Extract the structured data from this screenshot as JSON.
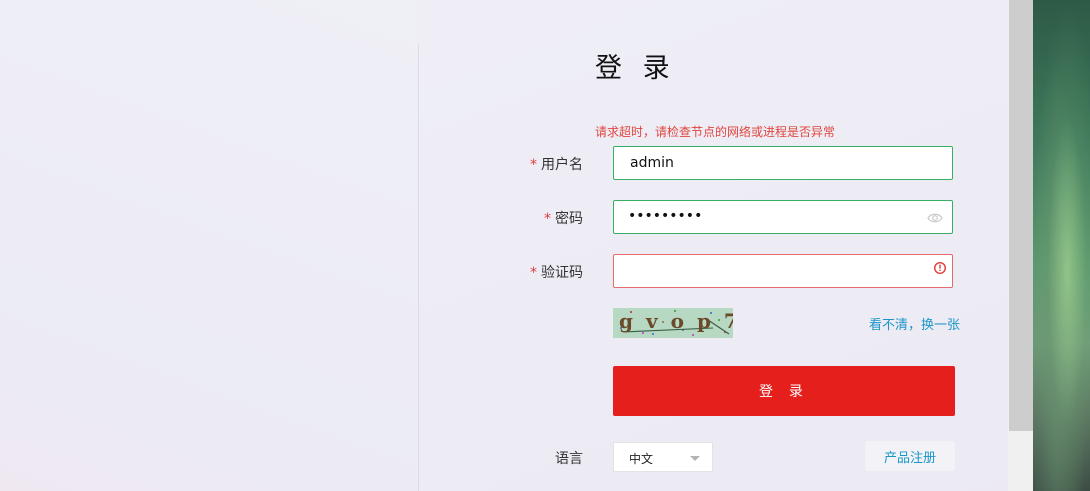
{
  "login": {
    "title": "登 录",
    "error_message": "请求超时，请检查节点的网络或进程是否异常",
    "required_mark": "*",
    "username_label": "用户名",
    "username_value": "admin",
    "password_label": "密码",
    "password_masked": "•••••••••",
    "captcha_label": "验证码",
    "captcha_value": "",
    "captcha_image_text": "gvop7",
    "refresh_captcha": "看不清，换一张",
    "submit_label": "登 录",
    "language_label": "语言",
    "language_value": "中文",
    "register_label": "产品注册"
  },
  "colors": {
    "accent_red": "#e51f1c",
    "valid_border": "#38ae63",
    "error_border": "#e46b6b",
    "link_blue": "#1b96c9",
    "error_text": "#e0463f"
  },
  "icons": {
    "password_toggle": "eye-icon",
    "captcha_error": "alert-circle-icon"
  }
}
